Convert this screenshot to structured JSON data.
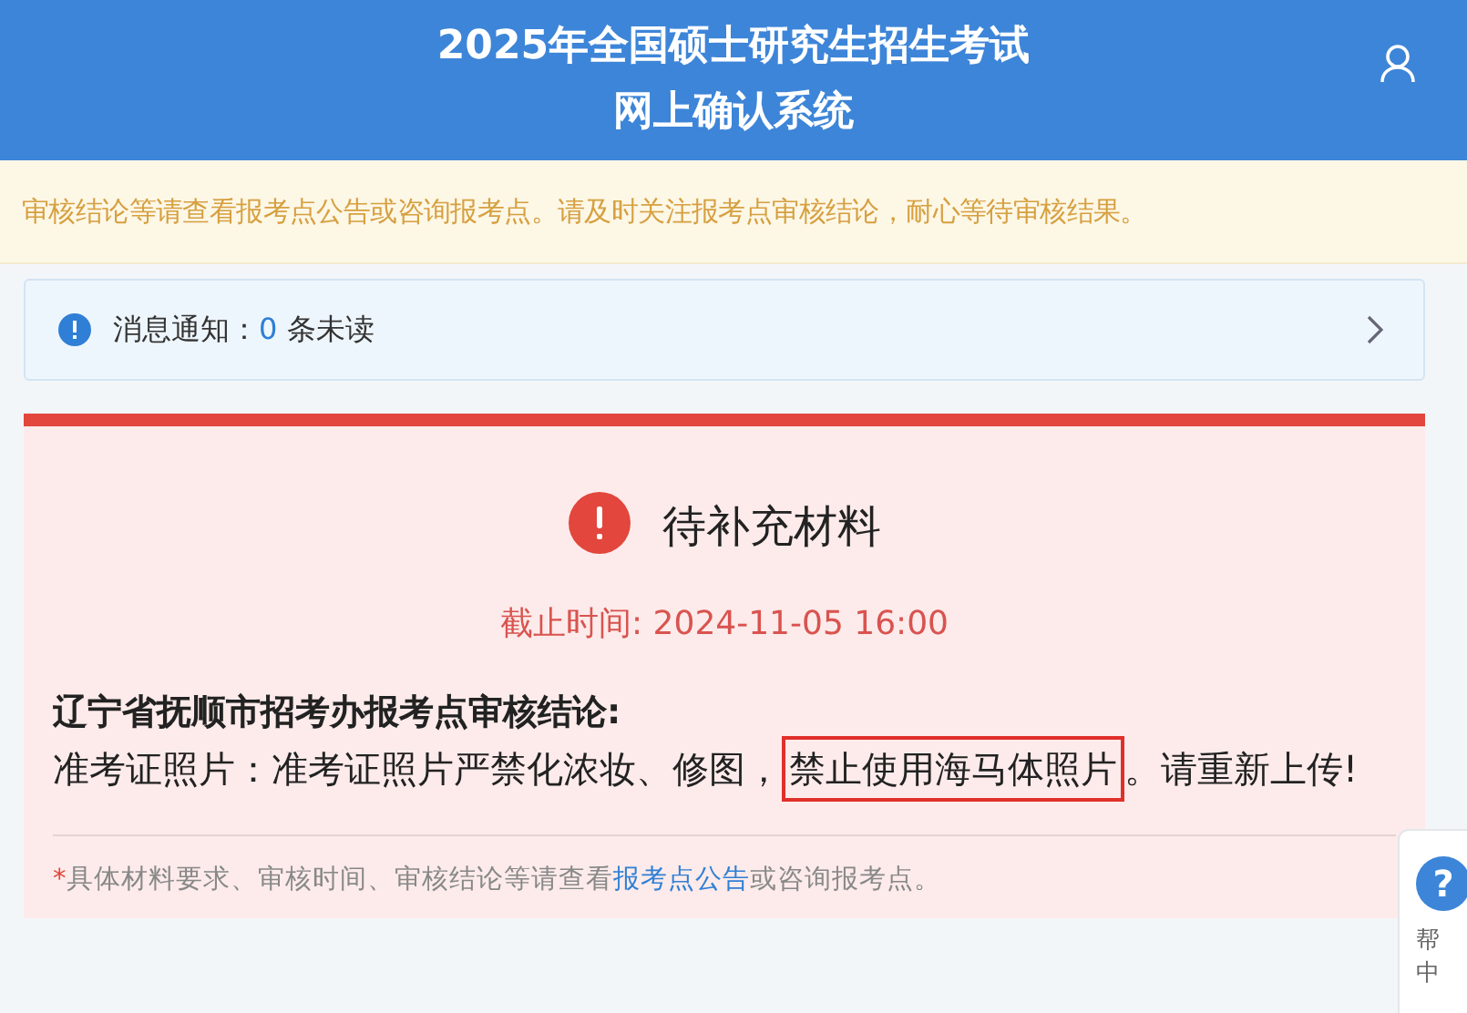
{
  "header": {
    "title_lines": [
      "2025年全国硕士研究生招生考试",
      "网上确认系统"
    ]
  },
  "notice": "审核结论等请查看报考点公告或咨询报考点。请及时关注报考点审核结论，耐心等待审核结果。",
  "messages": {
    "label": "消息通知：",
    "count": "0",
    "suffix": "条未读"
  },
  "status_card": {
    "title": "待补充材料",
    "deadline": "截止时间: 2024-11-05 16:00",
    "conclusion_heading": "辽宁省抚顺市招考办报考点审核结论:",
    "conclusion_parts": [
      {
        "text": "准考证照片：准考证照片严禁化浓妆、修图，",
        "highlighted": false
      },
      {
        "text": "禁止使用海马体照片",
        "highlighted": true
      },
      {
        "text": "。请重新上传!",
        "highlighted": false
      }
    ],
    "footnote": {
      "mark": "*",
      "before": "具体材料要求、审核时间、审核结论等请查看",
      "link": "报考点公告",
      "after": "或咨询报考点。"
    }
  },
  "help": {
    "icon": "?",
    "label_lines": [
      "帮",
      "中"
    ]
  }
}
